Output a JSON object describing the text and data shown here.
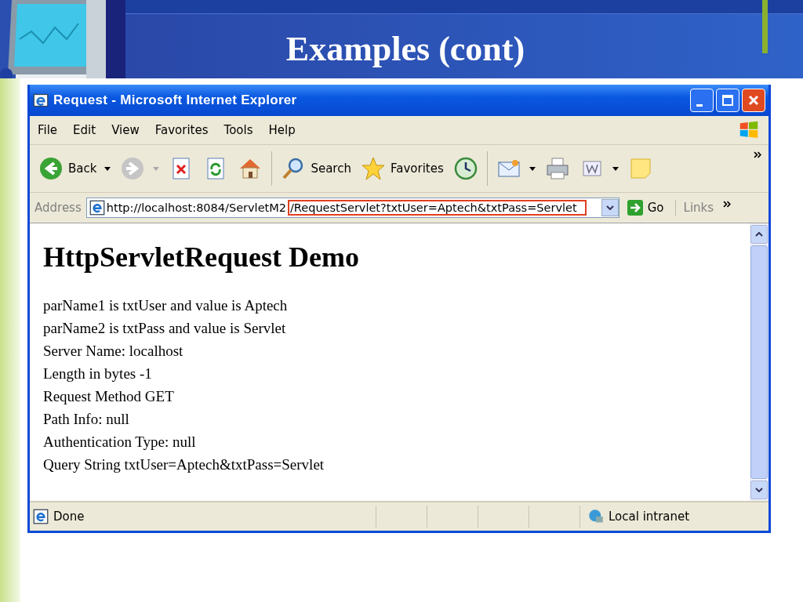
{
  "slide": {
    "title": "Examples (cont)"
  },
  "window": {
    "title": "Request - Microsoft Internet Explorer"
  },
  "menu": [
    "File",
    "Edit",
    "View",
    "Favorites",
    "Tools",
    "Help"
  ],
  "toolbar": [
    {
      "kind": "back",
      "label": "Back",
      "dropdown": true
    },
    {
      "kind": "forward",
      "dropdown": true
    },
    {
      "kind": "stop"
    },
    {
      "kind": "refresh"
    },
    {
      "kind": "home"
    },
    {
      "kind": "search",
      "label": "Search"
    },
    {
      "kind": "favorites",
      "label": "Favorites"
    },
    {
      "kind": "history"
    },
    {
      "kind": "mail",
      "dropdown": true
    },
    {
      "kind": "print"
    },
    {
      "kind": "word",
      "dropdown": true
    },
    {
      "kind": "note"
    }
  ],
  "address": {
    "label": "Address",
    "url_start": "http://localhost:8084/ServletM2",
    "url_highlighted": "/RequestServlet?txtUser=Aptech&txtPass=Servlet",
    "go": "Go",
    "links": "Links"
  },
  "page": {
    "heading": "HttpServletRequest Demo",
    "lines": [
      "parName1 is txtUser and value is Aptech",
      "parName2 is txtPass and value is Servlet",
      "Server Name: localhost",
      "Length in bytes -1",
      "Request Method GET",
      "Path Info: null",
      "Authentication Type: null",
      "Query String txtUser=Aptech&txtPass=Servlet"
    ]
  },
  "status_bar": {
    "status": "Done",
    "zone": "Local intranet"
  }
}
